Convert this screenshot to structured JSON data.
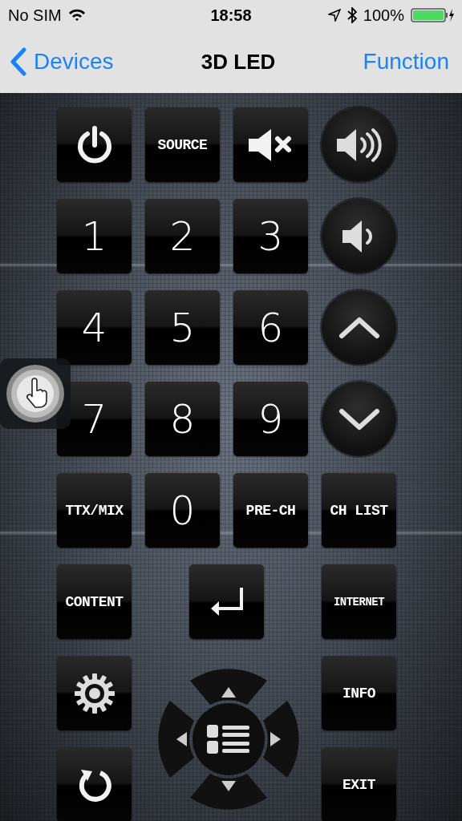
{
  "status_bar": {
    "carrier": "No SIM",
    "time": "18:58",
    "battery": "100%"
  },
  "nav": {
    "back": "Devices",
    "title": "3D LED",
    "action": "Function"
  },
  "keys": [
    {
      "kind": "power"
    },
    {
      "kind": "text",
      "label": "SOURCE"
    },
    {
      "kind": "mute"
    },
    {
      "kind": "volup"
    },
    {
      "kind": "number",
      "label": "1"
    },
    {
      "kind": "number",
      "label": "2"
    },
    {
      "kind": "number",
      "label": "3"
    },
    {
      "kind": "voldown"
    },
    {
      "kind": "number",
      "label": "4"
    },
    {
      "kind": "number",
      "label": "5"
    },
    {
      "kind": "number",
      "label": "6"
    },
    {
      "kind": "chup"
    },
    {
      "kind": "number",
      "label": "7"
    },
    {
      "kind": "number",
      "label": "8"
    },
    {
      "kind": "number",
      "label": "9"
    },
    {
      "kind": "chdown"
    },
    {
      "kind": "text",
      "label": "TTX/MIX"
    },
    {
      "kind": "number",
      "label": "0"
    },
    {
      "kind": "text",
      "label": "PRE-CH"
    },
    {
      "kind": "text",
      "label": "CH LIST"
    },
    {
      "kind": "text",
      "label": "CONTENT"
    },
    {
      "kind": "enter"
    },
    {
      "kind": "small",
      "label": "INTERNET"
    },
    {
      "kind": "gear"
    },
    {
      "kind": "dpad"
    },
    {
      "kind": "text",
      "label": "INFO"
    },
    {
      "kind": "refresh"
    },
    {
      "kind": "text",
      "label": "EXIT"
    }
  ]
}
